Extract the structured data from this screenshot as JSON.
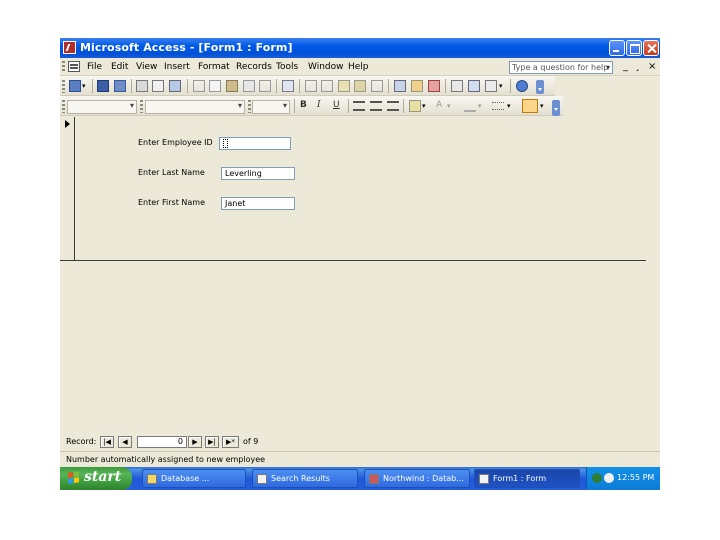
{
  "window": {
    "title": "Microsoft Access - [Form1 : Form]"
  },
  "menu": {
    "items": [
      "File",
      "Edit",
      "View",
      "Insert",
      "Format",
      "Records",
      "Tools",
      "Window",
      "Help"
    ],
    "help_placeholder": "Type a question for help",
    "mdi_min": "_",
    "mdi_restore": "¸",
    "mdi_close": "×"
  },
  "formatting": {
    "bold": "B",
    "italic": "I",
    "underline": "U",
    "font_color": "A"
  },
  "form": {
    "fields": [
      {
        "label": "Enter Employee ID",
        "value": ""
      },
      {
        "label": "Enter Last Name",
        "value": "Leverling"
      },
      {
        "label": "Enter First Name",
        "value": "Janet"
      }
    ]
  },
  "navigation": {
    "label": "Record:",
    "current_record": "0",
    "of_label": "of 9"
  },
  "status": {
    "text": "Number automatically assigned to new employee"
  },
  "taskbar": {
    "start_label": "start",
    "buttons": [
      {
        "label": "Database ..."
      },
      {
        "label": "Search Results"
      },
      {
        "label": "Northwind : Datab..."
      },
      {
        "label": "Form1 : Form"
      }
    ],
    "clock": "12:55 PM"
  },
  "colors": {
    "titlebar": "#0058e6",
    "window_bg": "#ece9d8",
    "taskbar": "#245edb",
    "start_button": "#3b9a3b",
    "tray": "#0d7bd8"
  },
  "icons": {
    "title_icon": "access-key-icon",
    "menu_doc_icon": "form-document-icon"
  }
}
